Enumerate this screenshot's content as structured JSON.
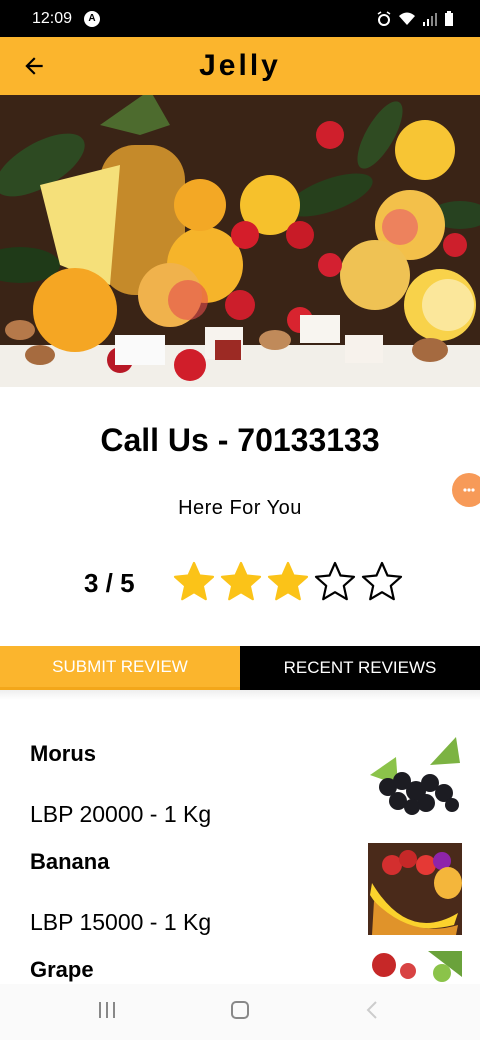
{
  "status_bar": {
    "time": "12:09",
    "badge": "A"
  },
  "app_bar": {
    "title": "Jelly"
  },
  "hero": {
    "image": "fruits-assortment"
  },
  "contact": {
    "call_us": "Call Us - 70133133",
    "tagline": "Here For You"
  },
  "rating": {
    "text": "3 / 5",
    "value": 3,
    "max": 5,
    "filled_color": "#fbc318"
  },
  "tabs": {
    "submit": "SUBMIT REVIEW",
    "recent": "RECENT REVIEWS"
  },
  "products": [
    {
      "name": "Morus",
      "price": "LBP 20000 - 1 Kg",
      "image": "blackberries"
    },
    {
      "name": "Banana",
      "price": "LBP 15000 - 1 Kg",
      "image": "fruit-bowl"
    },
    {
      "name": "Grape",
      "price": "",
      "image": "grapes"
    }
  ],
  "colors": {
    "accent": "#fbb52d",
    "dark": "#000000"
  }
}
